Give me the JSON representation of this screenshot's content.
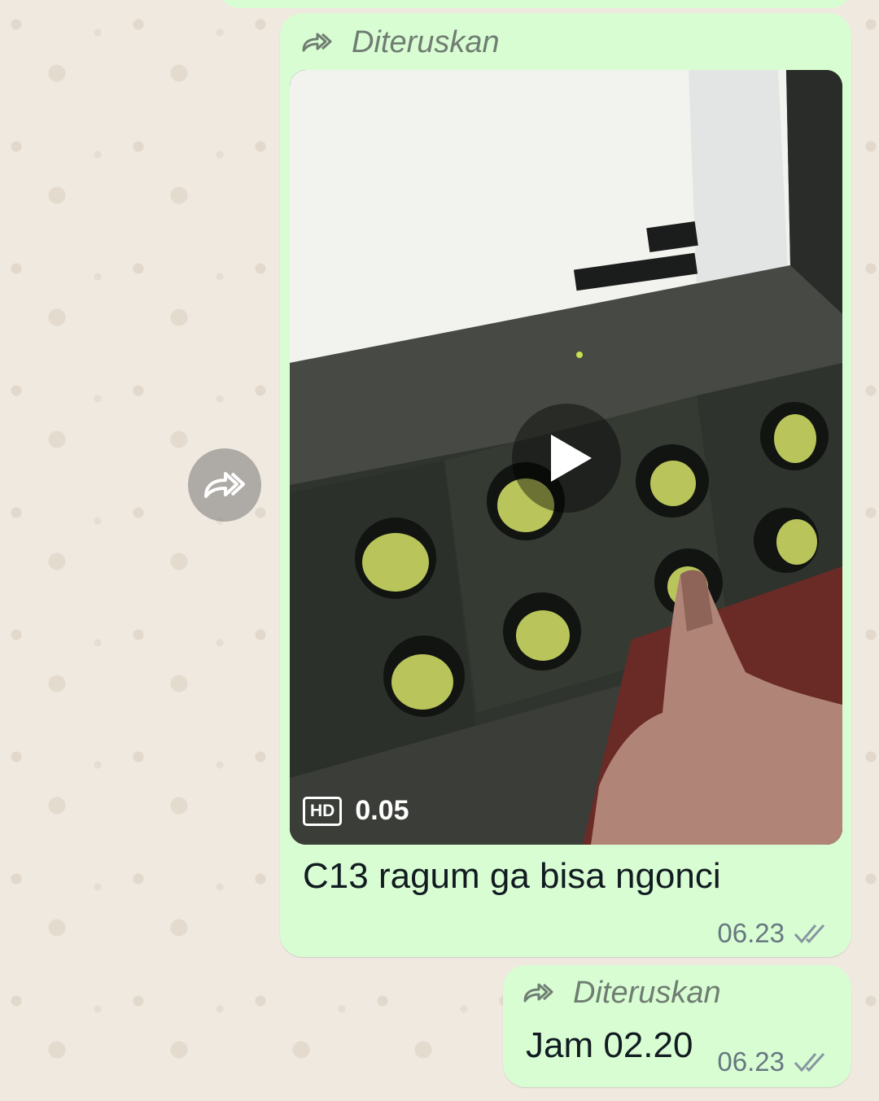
{
  "messages": [
    {
      "forwarded_label": "Diteruskan",
      "video": {
        "quality_badge": "HD",
        "duration": "0.05"
      },
      "caption": "C13 ragum ga bisa ngonci",
      "time": "06.23",
      "status_icon": "double-check-icon"
    },
    {
      "forwarded_label": "Diteruskan",
      "text": "Jam 02.20",
      "time": "06.23",
      "status_icon": "double-check-icon"
    }
  ],
  "actions": {
    "forward_icon": "forward-icon",
    "play_icon": "play-icon"
  },
  "colors": {
    "outgoing_bubble": "#d9fdd3",
    "chat_background": "#efe9e0",
    "meta_text": "#667781",
    "forward_text": "#6f7d72"
  }
}
